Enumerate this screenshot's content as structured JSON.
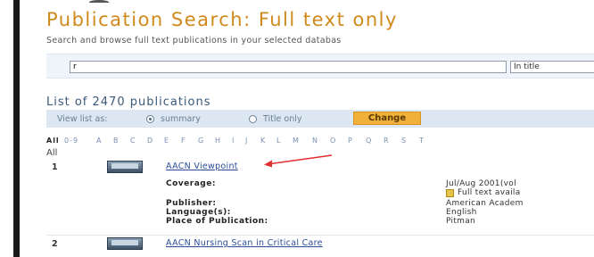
{
  "header": {
    "title": "Publication Search: Full text only",
    "subtitle": "Search and browse full text publications in your selected databas"
  },
  "search": {
    "value": "r",
    "field_select": "In title"
  },
  "list": {
    "title": "List of 2470 publications",
    "view_as_label": "View list as:",
    "view_options": [
      {
        "label": "summary",
        "selected": true
      },
      {
        "label": "Title only",
        "selected": false
      }
    ],
    "change_button": "Change",
    "alphabet": [
      "All",
      "0-9",
      "A",
      "B",
      "C",
      "D",
      "E",
      "F",
      "G",
      "H",
      "I",
      "J",
      "K",
      "L",
      "M",
      "N",
      "O",
      "P",
      "Q",
      "R",
      "S",
      "T"
    ],
    "active_letter": "All",
    "section_label": "All"
  },
  "publications": [
    {
      "number": "1",
      "title": "AACN Viewpoint",
      "fields": [
        {
          "label": "Coverage:",
          "value": "Jul/Aug 2001(vol"
        },
        {
          "label": "",
          "value": "Full text availa"
        },
        {
          "label": "Publisher:",
          "value": "American Academ"
        },
        {
          "label": "Language(s):",
          "value": "English"
        },
        {
          "label": "Place of Publication:",
          "value": "Pitman"
        }
      ]
    },
    {
      "number": "2",
      "title": "AACN Nursing Scan in Critical Care",
      "fields": []
    }
  ],
  "colors": {
    "title_orange": "#d08a1c",
    "link_blue": "#2a4d9a",
    "button_orange": "#f0b03a",
    "annotation_arrow": "#e03030"
  }
}
